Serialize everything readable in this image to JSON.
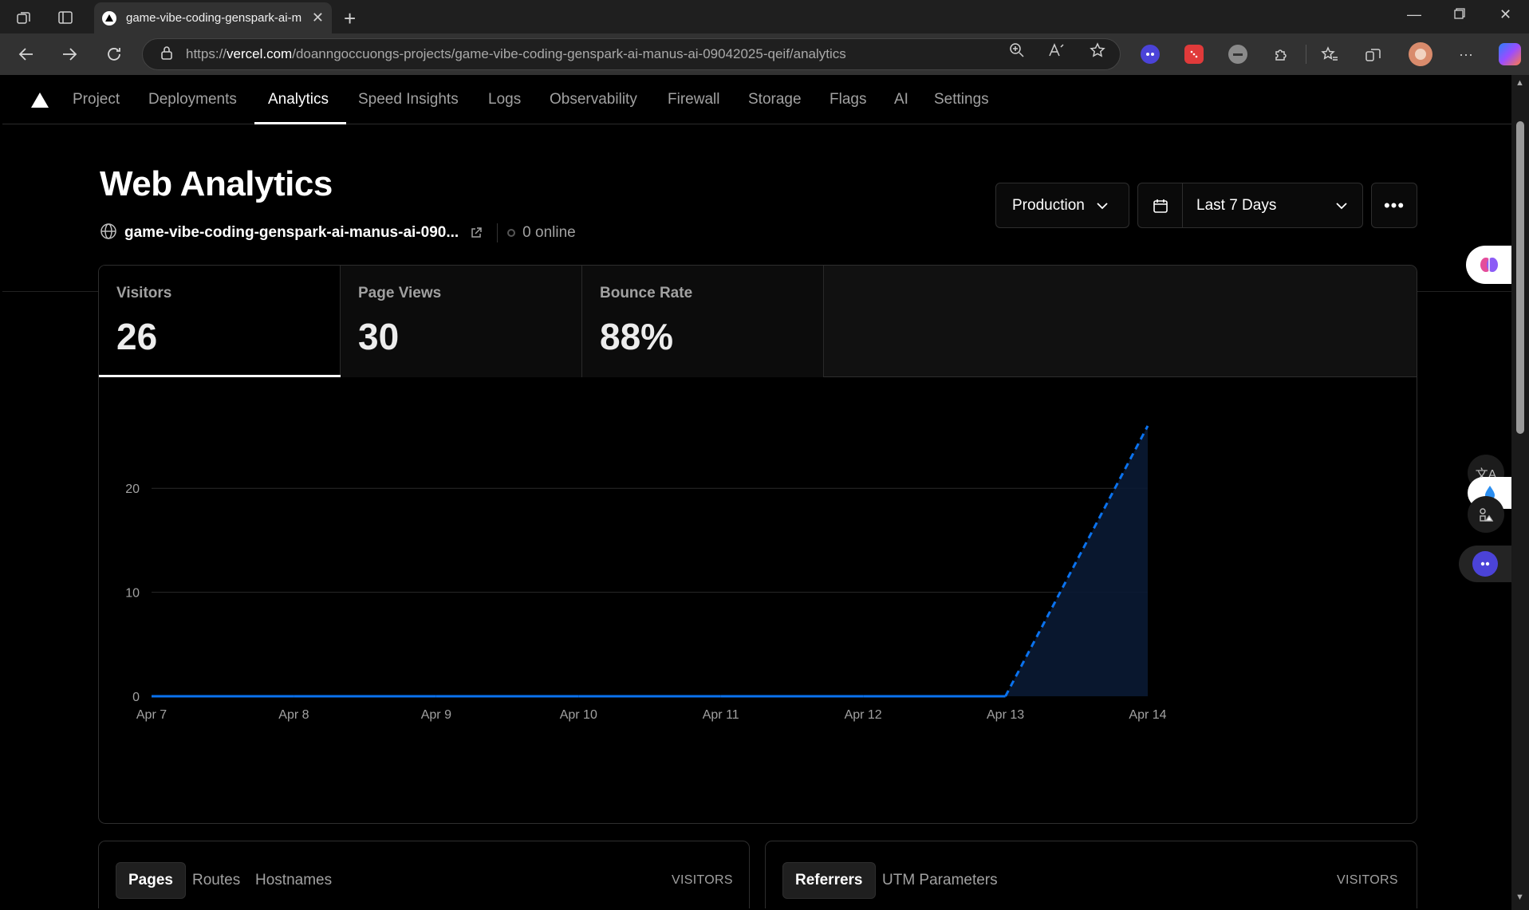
{
  "browser": {
    "tab_title": "game-vibe-coding-genspark-ai-m",
    "url_prefix": "https://",
    "url_domain": "vercel.com",
    "url_path": "/doanngoccuongs-projects/game-vibe-coding-genspark-ai-manus-ai-09042025-qeif/analytics"
  },
  "nav": {
    "items": [
      {
        "label": "Project"
      },
      {
        "label": "Deployments"
      },
      {
        "label": "Analytics"
      },
      {
        "label": "Speed Insights"
      },
      {
        "label": "Logs"
      },
      {
        "label": "Observability"
      },
      {
        "label": "Firewall"
      },
      {
        "label": "Storage"
      },
      {
        "label": "Flags"
      },
      {
        "label": "AI"
      },
      {
        "label": "Settings"
      }
    ],
    "active": "Analytics"
  },
  "header": {
    "title": "Web Analytics",
    "site": "game-vibe-coding-genspark-ai-manus-ai-090...",
    "online": "0 online"
  },
  "controls": {
    "environment": "Production",
    "range": "Last 7 Days"
  },
  "stats": [
    {
      "label": "Visitors",
      "value": "26"
    },
    {
      "label": "Page Views",
      "value": "30"
    },
    {
      "label": "Bounce Rate",
      "value": "88%"
    }
  ],
  "chart_data": {
    "type": "area",
    "x": [
      "Apr 7",
      "Apr 8",
      "Apr 9",
      "Apr 10",
      "Apr 11",
      "Apr 12",
      "Apr 13",
      "Apr 14"
    ],
    "values": [
      0,
      0,
      0,
      0,
      0,
      0,
      0,
      26
    ],
    "yticks": [
      0,
      10,
      20
    ],
    "ylim": [
      0,
      26
    ],
    "grid": true,
    "color": "#0a72ef",
    "dashed_segment": [
      "Apr 13",
      "Apr 14"
    ]
  },
  "cards": {
    "left": {
      "tabs": [
        "Pages",
        "Routes",
        "Hostnames"
      ],
      "active": "Pages",
      "column": "VISITORS"
    },
    "right": {
      "tabs": [
        "Referrers",
        "UTM Parameters"
      ],
      "active": "Referrers",
      "column": "VISITORS"
    }
  }
}
